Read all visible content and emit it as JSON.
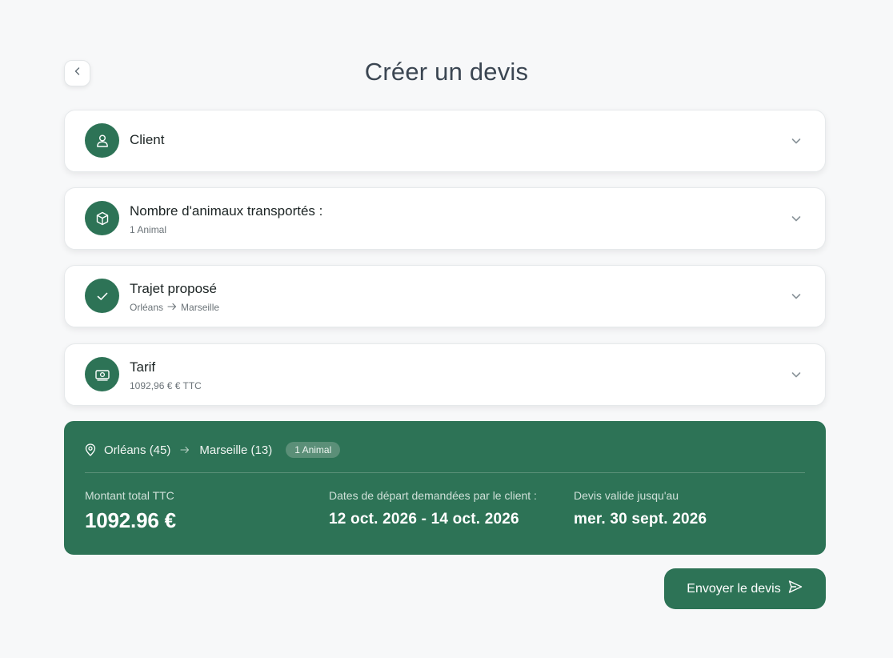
{
  "header": {
    "title": "Créer un devis",
    "back_icon": "chevron-left-icon"
  },
  "sections": [
    {
      "title": "Client",
      "subtitle": "",
      "icon": "user-icon"
    },
    {
      "title": "Nombre d'animaux transportés :",
      "subtitle": "1 Animal",
      "icon": "box-icon"
    },
    {
      "title": "Trajet proposé",
      "subtitle_from": "Orléans",
      "subtitle_to": "Marseille",
      "icon": "check-icon"
    },
    {
      "title": "Tarif",
      "subtitle": "1092,96 € € TTC",
      "icon": "banknote-icon"
    }
  ],
  "summary": {
    "from": "Orléans (45)",
    "to": "Marseille (13)",
    "badge": "1 Animal",
    "total_label": "Montant total TTC",
    "total_value": "1092.96 €",
    "dates_label": "Dates de départ demandées par le client :",
    "dates_value": "12 oct. 2026 - 14 oct. 2026",
    "valid_label": "Devis valide jusqu'au",
    "valid_value": "mer. 30 sept. 2026"
  },
  "actions": {
    "send_label": "Envoyer le devis",
    "send_icon": "send-icon"
  },
  "colors": {
    "brand_green": "#2d7356",
    "background": "#f7f8f9"
  }
}
